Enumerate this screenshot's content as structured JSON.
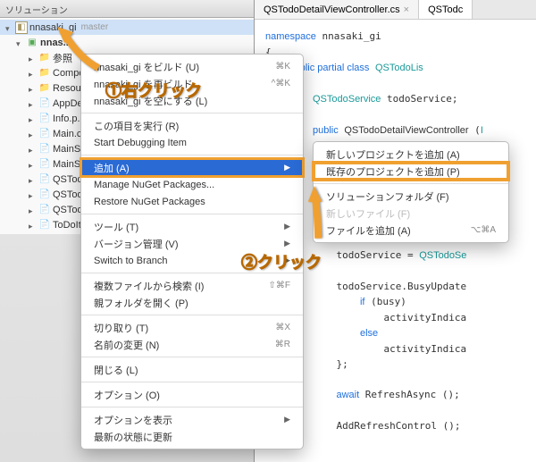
{
  "solution": {
    "header": "ソリューション",
    "root": "nnasaki_gi",
    "branch": "master",
    "project": "nnas...",
    "items": [
      {
        "label": "参照",
        "kind": "folder"
      },
      {
        "label": "Compo...",
        "kind": "folder"
      },
      {
        "label": "Resour...",
        "kind": "folder"
      },
      {
        "label": "AppDe...",
        "kind": "cs"
      },
      {
        "label": "Info.p...",
        "kind": "file"
      },
      {
        "label": "Main.c...",
        "kind": "cs"
      },
      {
        "label": "MainSt...",
        "kind": "file"
      },
      {
        "label": "MainSt...",
        "kind": "file"
      },
      {
        "label": "QSTod...",
        "kind": "cs"
      },
      {
        "label": "QSTod...",
        "kind": "cs"
      },
      {
        "label": "QSTod...",
        "kind": "cs"
      },
      {
        "label": "ToDoIt...",
        "kind": "cs"
      }
    ]
  },
  "editor": {
    "tabs": [
      {
        "label": "QSTodoDetailViewController.cs",
        "active": false
      },
      {
        "label": "QSTodc",
        "active": true
      }
    ]
  },
  "menu": {
    "build": "nnasaki_gi をビルド (U)",
    "build_sc": "⌘K",
    "rebuild": "nnasaki_gi を再ビルド",
    "rebuild_sc": "^⌘K",
    "clean": "nnasaki_gi を空にする (L)",
    "run": "この項目を実行 (R)",
    "debug": "Start Debugging Item",
    "add": "追加 (A)",
    "manage_nuget": "Manage NuGet Packages...",
    "restore_nuget": "Restore NuGet Packages",
    "tools": "ツール (T)",
    "vcs": "バージョン管理 (V)",
    "switch_branch": "Switch to Branch",
    "find_files": "複数ファイルから検索 (I)",
    "find_files_sc": "⇧⌘F",
    "open_parent": "親フォルダを開く (P)",
    "cut": "切り取り (T)",
    "cut_sc": "⌘X",
    "rename": "名前の変更 (N)",
    "rename_sc": "⌘R",
    "close": "閉じる (L)",
    "options": "オプション (O)",
    "show_options": "オプションを表示",
    "refresh": "最新の状態に更新"
  },
  "submenu": {
    "new_project": "新しいプロジェクトを追加 (A)",
    "existing_project": "既存のプロジェクトを追加 (P)",
    "solution_folder": "ソリューションフォルダ (F)",
    "new_file": "新しいファイル (F)",
    "add_file": "ファイルを追加 (A)",
    "add_file_sc": "⌥⌘A"
  },
  "callouts": {
    "c1": "①右クリック",
    "c2": "②クリック"
  }
}
